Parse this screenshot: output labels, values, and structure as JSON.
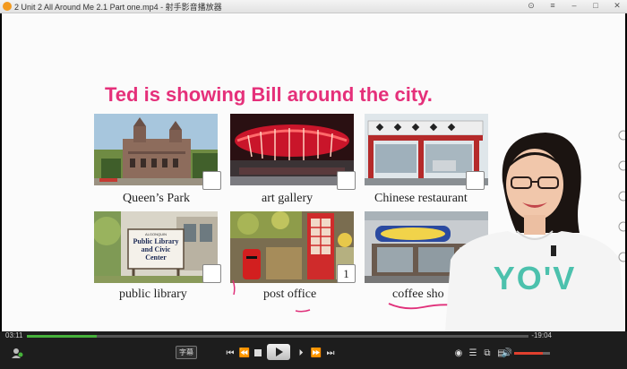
{
  "window": {
    "title": "2 Unit 2 All Around Me 2.1 Part one.mp4 - 射手影音播放器"
  },
  "lesson": {
    "heading": "Ted is showing Bill around the city.",
    "items": [
      {
        "caption": "Queen’s Park",
        "checkbox": ""
      },
      {
        "caption": "art gallery",
        "checkbox": ""
      },
      {
        "caption": "Chinese restaurant",
        "checkbox": ""
      },
      {
        "caption": "public library",
        "checkbox": ""
      },
      {
        "caption": "post office",
        "checkbox": "1"
      },
      {
        "caption": "coffee sho",
        "checkbox": ""
      }
    ],
    "library_sign": "Public Library and Civic Center",
    "library_sign_top": "ALGONQUIN",
    "shirt_text": "YO'V"
  },
  "player": {
    "elapsed": "03:11",
    "remaining": "-19:04",
    "subtitle_label": "字幕",
    "progress": 0.14,
    "volume": 0.8
  },
  "colors": {
    "heading": "#e5307a",
    "progress": "#46b23b",
    "volume": "#e0402e"
  }
}
